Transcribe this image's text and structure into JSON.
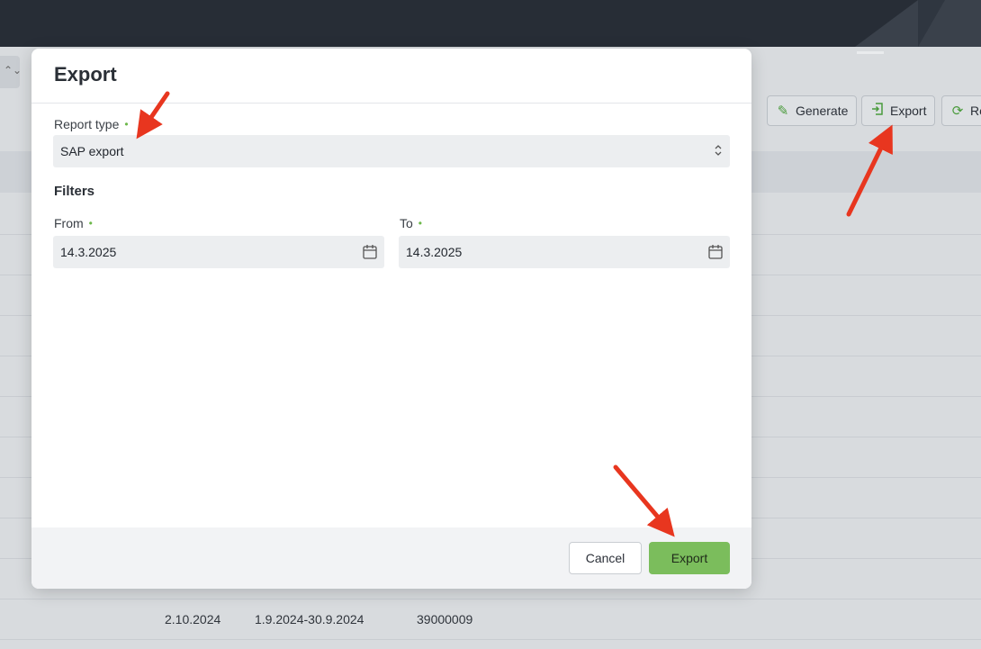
{
  "background": {
    "toolbar": {
      "generate_label": "Generate",
      "export_label": "Export",
      "refresh_label": "Re"
    },
    "table_row": {
      "date": "2.10.2024",
      "period": "1.9.2024-30.9.2024",
      "number": "39000009"
    }
  },
  "modal": {
    "title": "Export",
    "report_type": {
      "label": "Report type",
      "value": "SAP export"
    },
    "filters_title": "Filters",
    "from": {
      "label": "From",
      "value": "14.3.2025"
    },
    "to": {
      "label": "To",
      "value": "14.3.2025"
    },
    "cancel_label": "Cancel",
    "export_label": "Export"
  },
  "colors": {
    "accent_green": "#7bbd5c",
    "required_dot": "#6cb84a",
    "annotation_arrow": "#e8361f"
  }
}
